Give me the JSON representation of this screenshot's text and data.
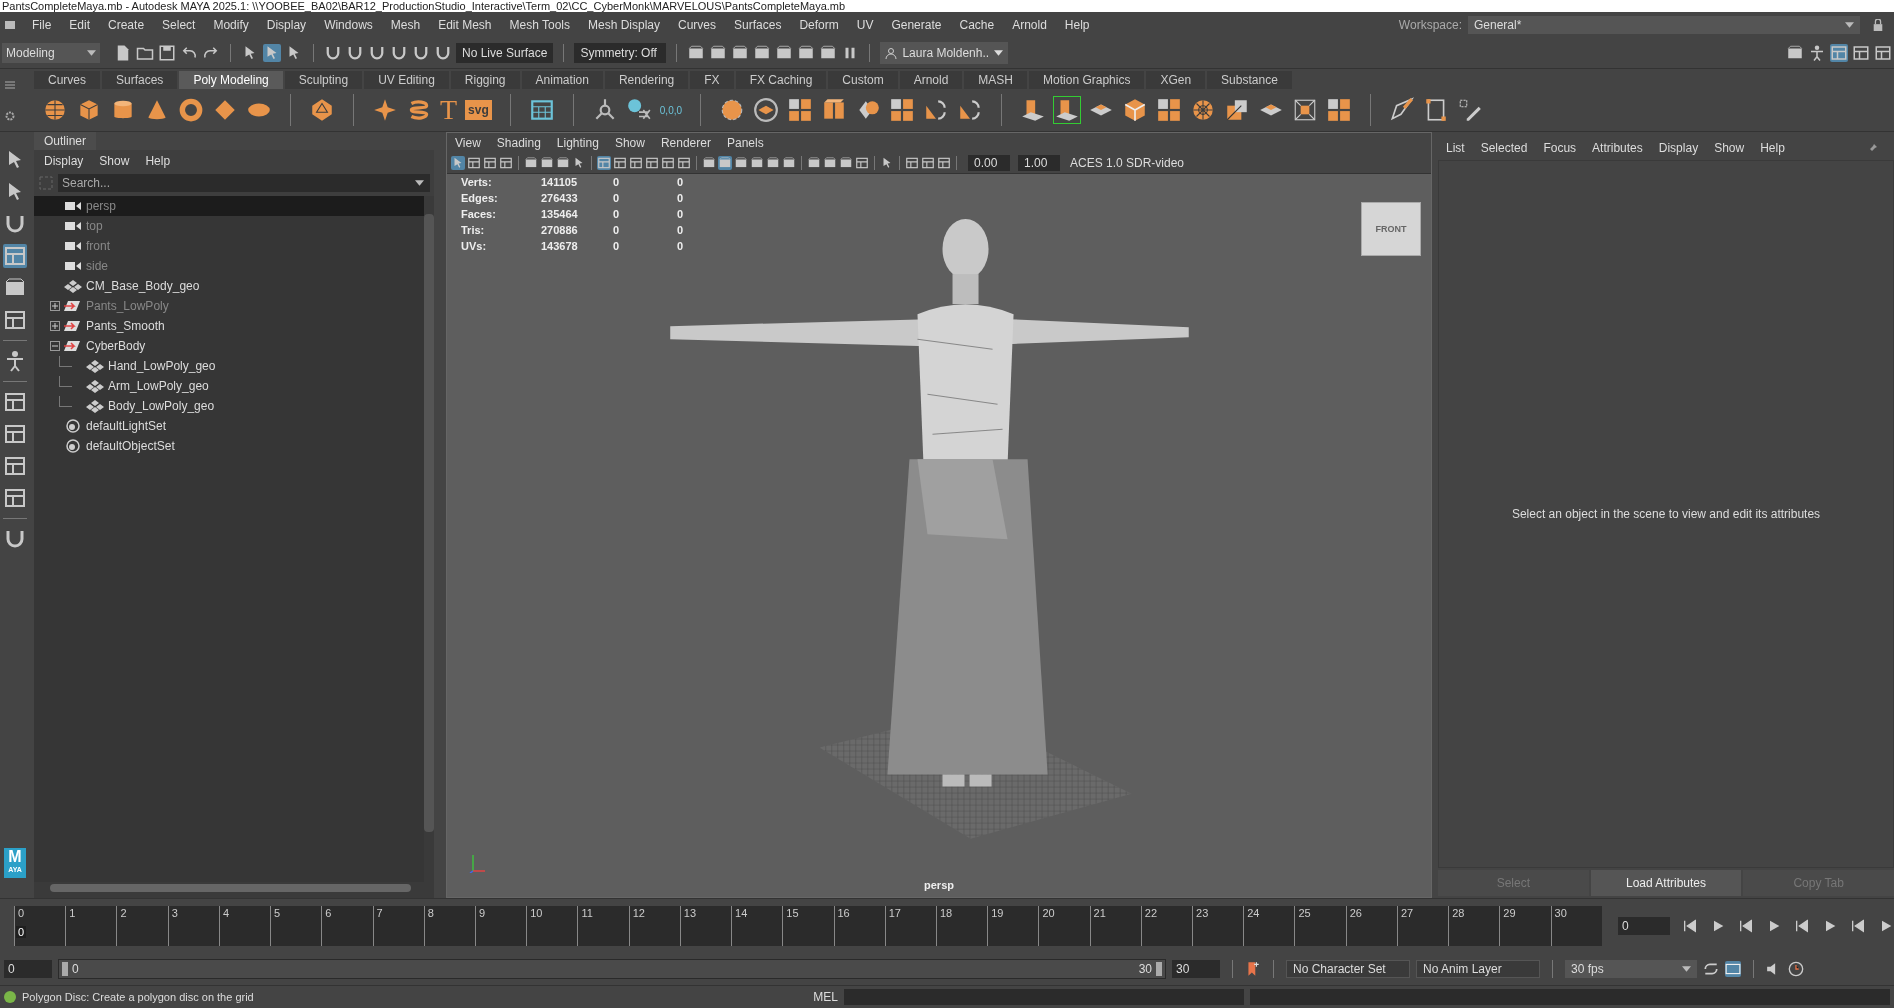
{
  "window": {
    "title": "PantsCompleteMaya.mb - Autodesk MAYA 2025.1: \\\\YOOBEE_BA02\\BAR12_ProductionStudio_Interactive\\Term_02\\CC_CyberMonk\\MARVELOUS\\PantsCompleteMaya.mb"
  },
  "menu": [
    "File",
    "Edit",
    "Create",
    "Select",
    "Modify",
    "Display",
    "Windows",
    "Mesh",
    "Edit Mesh",
    "Mesh Tools",
    "Mesh Display",
    "Curves",
    "Surfaces",
    "Deform",
    "UV",
    "Generate",
    "Cache",
    "Arnold",
    "Help"
  ],
  "workspace": {
    "label": "Workspace:",
    "value": "General*"
  },
  "toolbar": {
    "mode": "Modeling",
    "live_surface": "No Live Surface",
    "symmetry": "Symmetry: Off",
    "user": "Laura Moldenh.."
  },
  "shelf_tabs": [
    {
      "label": "Curves",
      "selected": false
    },
    {
      "label": "Surfaces",
      "selected": false
    },
    {
      "label": "Poly Modeling",
      "selected": true
    },
    {
      "label": "Sculpting",
      "selected": false
    },
    {
      "label": "UV Editing",
      "selected": false
    },
    {
      "label": "Rigging",
      "selected": false
    },
    {
      "label": "Animation",
      "selected": false
    },
    {
      "label": "Rendering",
      "selected": false
    },
    {
      "label": "FX",
      "selected": false
    },
    {
      "label": "FX Caching",
      "selected": false
    },
    {
      "label": "Custom",
      "selected": false
    },
    {
      "label": "Arnold",
      "selected": false
    },
    {
      "label": "MASH",
      "selected": false
    },
    {
      "label": "Motion Graphics",
      "selected": false
    },
    {
      "label": "XGen",
      "selected": false
    },
    {
      "label": "Substance",
      "selected": false
    }
  ],
  "shelf_texts": [
    "T",
    "svg",
    "0,0,0"
  ],
  "logo": {
    "letter": "M",
    "sub": "AYA"
  },
  "outliner": {
    "title": "Outliner",
    "menu": [
      "Display",
      "Show",
      "Help"
    ],
    "search": {
      "placeholder": "Search..."
    },
    "items": [
      {
        "name": "persp",
        "kind": "camera",
        "dimmed": true,
        "selected": true
      },
      {
        "name": "top",
        "kind": "camera",
        "dimmed": true,
        "selected": false
      },
      {
        "name": "front",
        "kind": "camera",
        "dimmed": true,
        "selected": false
      },
      {
        "name": "side",
        "kind": "camera",
        "dimmed": true,
        "selected": false
      },
      {
        "name": "CM_Base_Body_geo",
        "kind": "mesh",
        "dimmed": false,
        "selected": false
      },
      {
        "name": "Pants_LowPoly",
        "kind": "group",
        "dimmed": true,
        "selected": false,
        "expanded": false
      },
      {
        "name": "Pants_Smooth",
        "kind": "group",
        "dimmed": false,
        "selected": false,
        "expanded": false
      },
      {
        "name": "CyberBody",
        "kind": "group",
        "dimmed": false,
        "selected": false,
        "expanded": true,
        "children": [
          {
            "name": "Hand_LowPoly_geo",
            "kind": "mesh",
            "dimmed": false,
            "selected": false
          },
          {
            "name": "Arm_LowPoly_geo",
            "kind": "mesh",
            "dimmed": false,
            "selected": false
          },
          {
            "name": "Body_LowPoly_geo",
            "kind": "mesh",
            "dimmed": false,
            "selected": false
          }
        ]
      },
      {
        "name": "defaultLightSet",
        "kind": "set",
        "dimmed": false,
        "selected": false
      },
      {
        "name": "defaultObjectSet",
        "kind": "set",
        "dimmed": false,
        "selected": false
      }
    ]
  },
  "viewport": {
    "menu": [
      "View",
      "Shading",
      "Lighting",
      "Show",
      "Renderer",
      "Panels"
    ],
    "exposure": "0.00",
    "gamma": "1.00",
    "color_space": "ACES 1.0 SDR-video",
    "stats": [
      {
        "label": "Verts:",
        "values": [
          "141105",
          "0",
          "0"
        ]
      },
      {
        "label": "Edges:",
        "values": [
          "276433",
          "0",
          "0"
        ]
      },
      {
        "label": "Faces:",
        "values": [
          "135464",
          "0",
          "0"
        ]
      },
      {
        "label": "Tris:",
        "values": [
          "270886",
          "0",
          "0"
        ]
      },
      {
        "label": "UVs:",
        "values": [
          "143678",
          "0",
          "0"
        ]
      }
    ],
    "cube_label": "FRONT",
    "camera": "persp"
  },
  "attribute_editor": {
    "menu": [
      "List",
      "Selected",
      "Focus",
      "Attributes",
      "Display",
      "Show",
      "Help"
    ],
    "message": "Select an object in the scene to view and edit its attributes",
    "buttons": [
      {
        "label": "Select",
        "disabled": true
      },
      {
        "label": "Load Attributes",
        "disabled": false
      },
      {
        "label": "Copy Tab",
        "disabled": true
      }
    ]
  },
  "timeline": {
    "ticks": [
      "0",
      "1",
      "2",
      "3",
      "4",
      "5",
      "6",
      "7",
      "8",
      "9",
      "10",
      "11",
      "12",
      "13",
      "14",
      "15",
      "16",
      "17",
      "18",
      "19",
      "20",
      "21",
      "22",
      "23",
      "24",
      "25",
      "26",
      "27",
      "28",
      "29",
      "30"
    ],
    "current": "0",
    "level": 0,
    "frame_field": "0"
  },
  "range": {
    "start": "0",
    "slider_start": "0",
    "slider_end": "30",
    "level": 1,
    "end": "30",
    "character_set": "No Character Set",
    "anim_layer": "No Anim Layer",
    "fps": "30 fps"
  },
  "status": {
    "message": "Polygon Disc: Create a polygon disc on the grid",
    "mel": "MEL"
  }
}
